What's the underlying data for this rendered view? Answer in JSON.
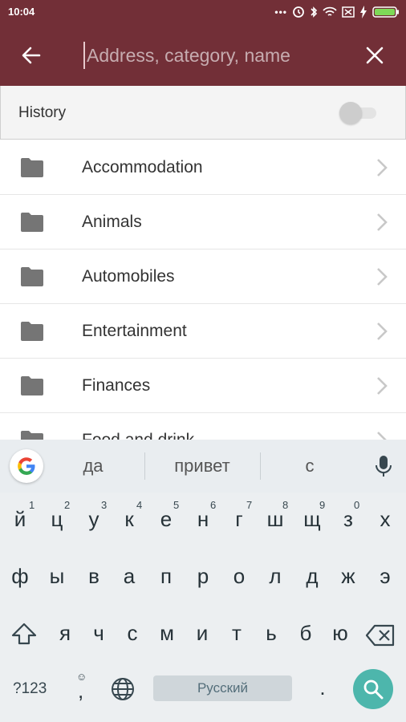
{
  "status_bar": {
    "time": "10:04",
    "icons": [
      "more-dots-icon",
      "alarm-icon",
      "bluetooth-icon",
      "wifi-icon",
      "no-sim-icon",
      "charging-icon",
      "battery-icon"
    ],
    "battery_color": "#7ed957"
  },
  "app_bar": {
    "background": "#722f37",
    "search_placeholder": "Address, category, name",
    "search_value": ""
  },
  "history": {
    "label": "History",
    "toggle_on": false
  },
  "categories": [
    {
      "label": "Accommodation"
    },
    {
      "label": "Animals"
    },
    {
      "label": "Automobiles"
    },
    {
      "label": "Entertainment"
    },
    {
      "label": "Finances"
    },
    {
      "label": "Food and drink"
    }
  ],
  "keyboard": {
    "suggestions": [
      "да",
      "привет",
      "с"
    ],
    "row1": [
      "й",
      "ц",
      "у",
      "к",
      "е",
      "н",
      "г",
      "ш",
      "щ",
      "з",
      "х"
    ],
    "row1_hints": [
      "1",
      "2",
      "3",
      "4",
      "5",
      "6",
      "7",
      "8",
      "9",
      "0",
      ""
    ],
    "row2": [
      "ф",
      "ы",
      "в",
      "а",
      "п",
      "р",
      "о",
      "л",
      "д",
      "ж",
      "э"
    ],
    "row3": [
      "я",
      "ч",
      "с",
      "м",
      "и",
      "т",
      "ь",
      "б",
      "ю"
    ],
    "symbols_label": "?123",
    "comma_label": ",",
    "space_label": "Русский",
    "period_label": ".",
    "accent_color": "#4db6ac"
  }
}
